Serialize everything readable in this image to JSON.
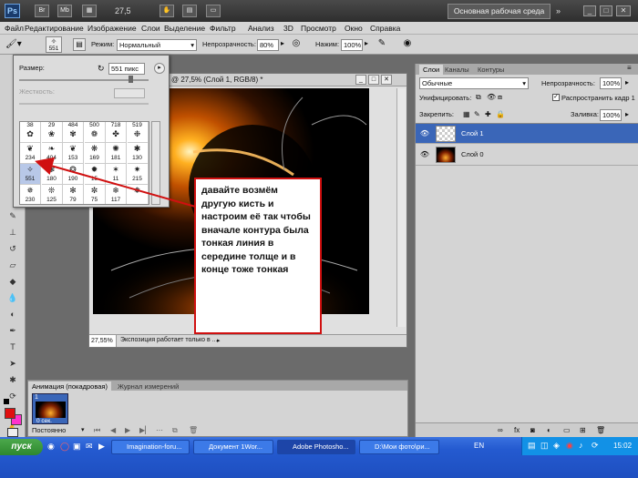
{
  "titlebar": {
    "logo": "Ps",
    "icon_br": "Br",
    "icon_mb": "Mb",
    "zoom": "27,5",
    "workspace": "Основная рабочая среда"
  },
  "menus": [
    "Файл",
    "Редактирование",
    "Изображение",
    "Слои",
    "Выделение",
    "Фильтр",
    "Анализ",
    "3D",
    "Просмотр",
    "Окно",
    "Справка"
  ],
  "options": {
    "brush_size": "551",
    "mode_label": "Режим:",
    "mode_value": "Нормальный",
    "opacity_label": "Непрозрачность:",
    "opacity_value": "80%",
    "pressure_label": "Нажим:",
    "pressure_value": "100%"
  },
  "brush_panel": {
    "size_label": "Размер:",
    "size_value": "551 пикс",
    "hardness_label": "Жесткость:",
    "presets": [
      {
        "num": "38",
        "glyph": "✿"
      },
      {
        "num": "29",
        "glyph": "❀"
      },
      {
        "num": "484",
        "glyph": "✾"
      },
      {
        "num": "500",
        "glyph": "❁"
      },
      {
        "num": "718",
        "glyph": "✤"
      },
      {
        "num": "519",
        "glyph": "❉"
      },
      {
        "num": "234",
        "glyph": "❦"
      },
      {
        "num": "404",
        "glyph": "❧"
      },
      {
        "num": "153",
        "glyph": "❦"
      },
      {
        "num": "169",
        "glyph": "❋"
      },
      {
        "num": "181",
        "glyph": "✺"
      },
      {
        "num": "130",
        "glyph": "✱"
      },
      {
        "num": "551",
        "glyph": "✧"
      },
      {
        "num": "180",
        "glyph": "❃"
      },
      {
        "num": "190",
        "glyph": "❂"
      },
      {
        "num": "15",
        "glyph": "✹"
      },
      {
        "num": "11",
        "glyph": "✶"
      },
      {
        "num": "215",
        "glyph": "✷"
      },
      {
        "num": "230",
        "glyph": "✵"
      },
      {
        "num": "125",
        "glyph": "❊"
      },
      {
        "num": "79",
        "glyph": "✻"
      },
      {
        "num": "75",
        "glyph": "✼"
      },
      {
        "num": "117",
        "glyph": "❄"
      },
      {
        "num": "",
        "glyph": "❅"
      }
    ]
  },
  "document": {
    "title": "@ 27,5% (Слой 1, RGB/8) *",
    "zoom_status": "27,55%",
    "status_text": "Экспозиция работает только в ..."
  },
  "callout": {
    "text": "давайте возмём другую кисть и настроим её так чтобы вначале контура была тонкая линия в середине толще и в конце тоже тонкая"
  },
  "layers_panel": {
    "tabs": [
      "Слои",
      "Каналы",
      "Контуры"
    ],
    "blend_mode": "Обычные",
    "opacity_label": "Непрозрачность:",
    "opacity_value": "100%",
    "unify_label": "Унифицировать:",
    "propagate_label": "Распространить кадр 1",
    "lock_label": "Закрепить:",
    "fill_label": "Заливка:",
    "fill_value": "100%",
    "layers": [
      {
        "name": "Слой 1",
        "selected": true
      },
      {
        "name": "Слой 0",
        "selected": false
      }
    ]
  },
  "animation_panel": {
    "tabs": [
      "Анимация (покадровая)",
      "Журнал измерений"
    ],
    "frame_number": "1",
    "frame_delay": "0 сек.",
    "loop": "Постоянно"
  },
  "taskbar": {
    "start": "пуск",
    "tasks": [
      {
        "label": "Imagination-foru...",
        "active": false
      },
      {
        "label": "Документ 1Wor...",
        "active": false
      },
      {
        "label": "Adobe Photosho...",
        "active": true
      },
      {
        "label": "D:\\Мои фото\\ри...",
        "active": false
      }
    ],
    "lang": "EN",
    "clock": "15:02"
  },
  "colors": {
    "accent_red": "#d01010",
    "layer_selected": "#3a66b8",
    "taskbar_blue": "#245ad0",
    "foreground": "#e01010",
    "background": "#ff33cc"
  }
}
